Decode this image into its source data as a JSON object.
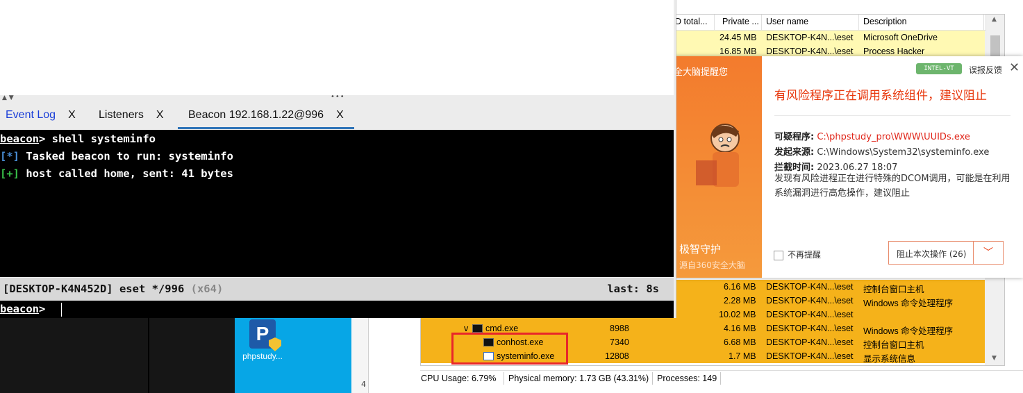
{
  "cobalt_strike": {
    "tabs": [
      {
        "label": "Event Log",
        "close": "X"
      },
      {
        "label": "Listeners",
        "close": "X"
      },
      {
        "label": "Beacon 192.168.1.22@996",
        "close": "X"
      }
    ],
    "console": {
      "prompt_word": "beacon",
      "prompt_sym": ">",
      "command": " shell systeminfo",
      "line2_tag": "[*]",
      "line2_text": " Tasked beacon to run: systeminfo",
      "line3_tag": "[+]",
      "line3_text": " host called home, sent: 41 bytes"
    },
    "status": {
      "session": "[DESKTOP-K4N452D] eset */996 ",
      "arch": "(x64)",
      "last": "last: 8s"
    },
    "input_prompt_word": "beacon",
    "input_prompt_sym": ">"
  },
  "desktop": {
    "icon_label": "phpstudy...",
    "icon_glyph": "P",
    "page_number": "4"
  },
  "process_hacker": {
    "columns": {
      "total": "D total...",
      "private": "Private ...",
      "user": "User name",
      "desc": "Description"
    },
    "rows_top": [
      {
        "private": "24.45 MB",
        "user": "DESKTOP-K4N...\\eset",
        "desc": "Microsoft OneDrive"
      },
      {
        "private": "16.85 MB",
        "user": "DESKTOP-K4N...\\eset",
        "desc": "Process Hacker"
      }
    ],
    "rows_bottom": [
      {
        "name": "",
        "pid": "",
        "private": "6.16 MB",
        "user": "DESKTOP-K4N...\\eset",
        "desc": "控制台窗口主机"
      },
      {
        "name": "",
        "pid": "",
        "private": "2.28 MB",
        "user": "DESKTOP-K4N...\\eset",
        "desc": "Windows 命令处理程序"
      },
      {
        "name": "",
        "pid": "",
        "private": "10.02 MB",
        "user": "DESKTOP-K4N...\\eset",
        "desc": ""
      },
      {
        "name": "cmd.exe",
        "pid": "8988",
        "private": "4.16 MB",
        "user": "DESKTOP-K4N...\\eset",
        "desc": "Windows 命令处理程序"
      },
      {
        "name": "conhost.exe",
        "pid": "7340",
        "private": "6.68 MB",
        "user": "DESKTOP-K4N...\\eset",
        "desc": "控制台窗口主机"
      },
      {
        "name": "systeminfo.exe",
        "pid": "12808",
        "private": "1.7 MB",
        "user": "DESKTOP-K4N...\\eset",
        "desc": "显示系统信息"
      }
    ],
    "tree_toggle": "v",
    "status": {
      "cpu": "CPU Usage: 6.79%",
      "memory": "Physical memory: 1.73 GB (43.31%)",
      "processes": "Processes: 149"
    }
  },
  "popup_360": {
    "left_top": "全大脑提醒您",
    "left_brand": "极智守护",
    "left_sub": "源自360安全大脑",
    "badge": "INTEL-VT",
    "feedback": "误报反馈",
    "close": "✕",
    "title": "有风险程序正在调用系统组件，建议阻止",
    "suspicious_label": "可疑程序:",
    "suspicious_value": "C:\\phpstudy_pro\\WWW\\UUIDs.exe",
    "source_label": "发起来源:",
    "source_value": "C:\\Windows\\System32\\systeminfo.exe",
    "time_label": "拦截时间:",
    "time_value": "2023.06.27 18:07",
    "description": "发现有风险进程正在进行特殊的DCOM调用，可能是在利用系统漏洞进行高危操作，建议阻止",
    "dont_remind": "不再提醒",
    "block_button": "阻止本次操作 (26)",
    "dropdown": "﹀"
  },
  "colors": {
    "highlight_orange": "#f5b21a",
    "highlight_yellow": "#fff9b3",
    "alert_red": "#e8380d",
    "tab_underline": "#2e73b8"
  }
}
